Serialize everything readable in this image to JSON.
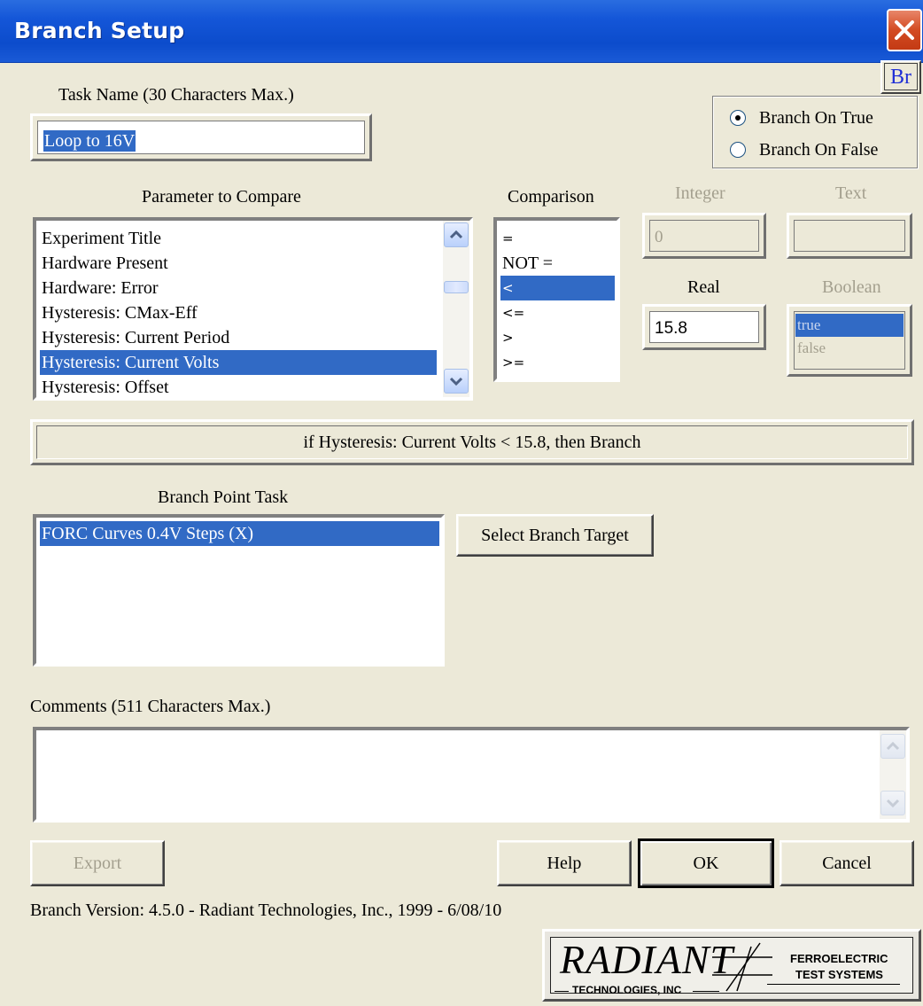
{
  "window": {
    "title": "Branch Setup"
  },
  "task_name": {
    "label": "Task Name (30 Characters Max.)",
    "value": "Loop to 16V"
  },
  "br_badge": "Br",
  "branch_mode": {
    "options": [
      "Branch On True",
      "Branch On False"
    ],
    "selected": "Branch On True"
  },
  "parameter": {
    "label": "Parameter to  Compare",
    "items": [
      "Experiment Title",
      "Hardware Present",
      "Hardware: Error",
      "Hysteresis: CMax-Eff",
      "Hysteresis: Current Period",
      "Hysteresis: Current Volts",
      "Hysteresis: Offset"
    ],
    "selected": "Hysteresis: Current Volts"
  },
  "comparison": {
    "label": "Comparison",
    "items": [
      "=",
      "NOT =",
      "<",
      "<=",
      ">",
      ">="
    ],
    "selected": "<"
  },
  "integer": {
    "label": "Integer",
    "value": "0"
  },
  "text": {
    "label": "Text",
    "value": ""
  },
  "real": {
    "label": "Real",
    "value": "15.8"
  },
  "boolean": {
    "label": "Boolean",
    "items": [
      "true",
      "false"
    ],
    "selected": "true"
  },
  "summary": "if Hysteresis: Current Volts < 15.8, then Branch",
  "branch_point": {
    "label": "Branch Point Task",
    "items": [
      "FORC Curves 0.4V Steps (X)"
    ],
    "selected": "FORC Curves 0.4V Steps (X)",
    "select_button": "Select Branch Target"
  },
  "comments": {
    "label": "Comments (511 Characters Max.)",
    "value": ""
  },
  "buttons": {
    "export": "Export",
    "help": "Help",
    "ok": "OK",
    "cancel": "Cancel"
  },
  "version": "Branch Version: 4.5.0 - Radiant Technologies, Inc., 1999 - 6/08/10",
  "logo": {
    "brand": "RADIANT",
    "sub": "TECHNOLOGIES, INC",
    "tag1": "FERROELECTRIC",
    "tag2": "TEST SYSTEMS"
  },
  "colors": {
    "titlebar": "#0c4ccc",
    "selection": "#316ac5",
    "dialog_bg": "#ece9d8"
  }
}
